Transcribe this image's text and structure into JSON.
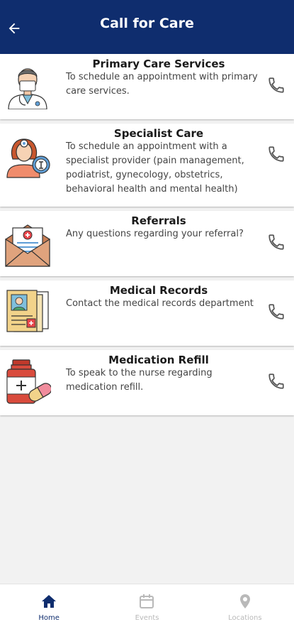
{
  "header": {
    "title": "Call for Care",
    "back_icon": "arrow-left-icon"
  },
  "colors": {
    "brand": "#0f2d6e",
    "inactive": "#b9b9b9"
  },
  "services": [
    {
      "title": "Primary Care Services",
      "description": "To schedule an appointment with primary care services.",
      "icon": "doctor-icon"
    },
    {
      "title": "Specialist Care",
      "description": "To schedule an appointment with a specialist provider (pain management, podiatrist, gynecology, obstetrics, behavioral health and mental health)",
      "icon": "specialist-doctor-icon"
    },
    {
      "title": "Referrals",
      "description": "Any questions regarding your referral?",
      "icon": "medical-envelope-icon"
    },
    {
      "title": "Medical Records",
      "description": "Contact the medical records department",
      "icon": "medical-records-icon"
    },
    {
      "title": "Medication Refill",
      "description": "To speak to the nurse regarding medication refill.",
      "icon": "medication-bottle-icon"
    }
  ],
  "nav": [
    {
      "label": "Home",
      "icon": "home-icon",
      "active": true
    },
    {
      "label": "Events",
      "icon": "calendar-icon",
      "active": false
    },
    {
      "label": "Locations",
      "icon": "location-pin-icon",
      "active": false
    }
  ]
}
